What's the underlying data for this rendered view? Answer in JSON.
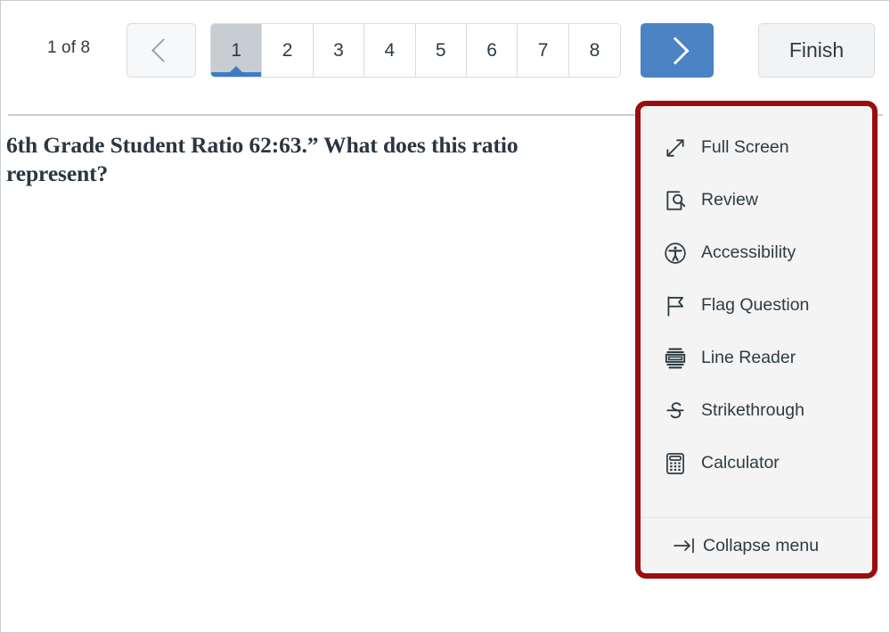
{
  "toolbar": {
    "counter": "1 of 8",
    "prev_button": {
      "name": "previous-question",
      "icon": "chevron-left-icon"
    },
    "next_button": {
      "name": "next-question",
      "icon": "chevron-right-icon"
    },
    "pages": [
      "1",
      "2",
      "3",
      "4",
      "5",
      "6",
      "7",
      "8"
    ],
    "active_page": "1",
    "finish_label": "Finish"
  },
  "question": {
    "text": "6th Grade Student Ratio 62:63.” What does this ratio represent?"
  },
  "tool_menu": {
    "highlight_color": "#9B0D0D",
    "background_color": "#F4F4F4",
    "items": [
      {
        "label": "Full Screen",
        "icon": "full-screen-icon"
      },
      {
        "label": "Review",
        "icon": "review-icon"
      },
      {
        "label": "Accessibility",
        "icon": "accessibility-icon"
      },
      {
        "label": "Flag Question",
        "icon": "flag-icon"
      },
      {
        "label": "Line Reader",
        "icon": "line-reader-icon"
      },
      {
        "label": "Strikethrough",
        "icon": "strikethrough-icon"
      },
      {
        "label": "Calculator",
        "icon": "calculator-icon"
      }
    ],
    "footer": {
      "label": "Collapse menu",
      "icon": "collapse-arrow-icon"
    }
  }
}
